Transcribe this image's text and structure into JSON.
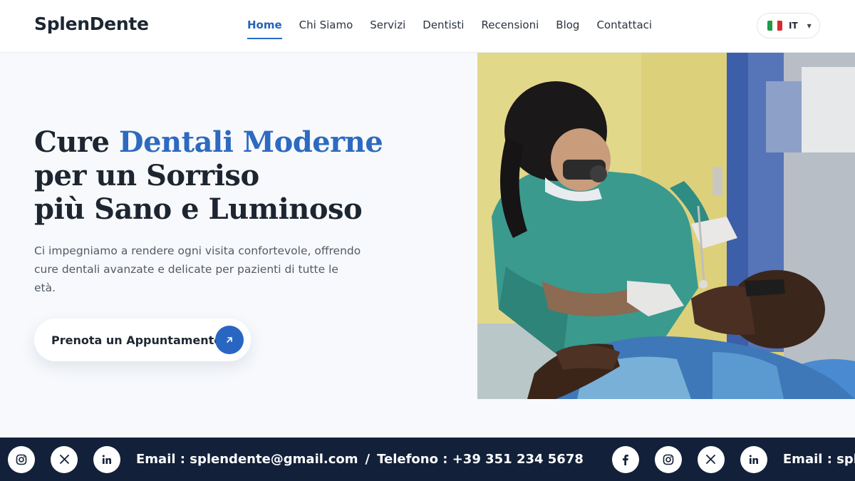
{
  "brand": {
    "name": "SplenDente"
  },
  "nav": {
    "items": [
      {
        "label": "Home",
        "active": true
      },
      {
        "label": "Chi Siamo",
        "active": false
      },
      {
        "label": "Servizi",
        "active": false
      },
      {
        "label": "Dentisti",
        "active": false
      },
      {
        "label": "Recensioni",
        "active": false
      },
      {
        "label": "Blog",
        "active": false
      },
      {
        "label": "Contattaci",
        "active": false
      }
    ]
  },
  "language": {
    "code": "IT",
    "flag": "italy-flag-icon",
    "colors": [
      "#1f9b4a",
      "#ffffff",
      "#d62b30"
    ]
  },
  "hero": {
    "title_part1": "Cure ",
    "title_accent": "Dentali Moderne",
    "title_line2": "per un Sorriso",
    "title_line3": "più Sano e Luminoso",
    "description": "Ci impegniamo a rendere ogni visita confortevole, offrendo cure dentali avanzate e delicate per pazienti di tutte le età.",
    "cta_label": "Prenota un Appuntamento",
    "cta_icon": "arrow-up-right-icon"
  },
  "photo": {
    "icon": "dentist-treating-patient-image"
  },
  "ticker": {
    "contact_email": "Email : splendente@gmail.com",
    "separator": "/",
    "contact_phone": "Telefono : +39 351 234 5678",
    "contact_email_repeat": "Email : splendente@",
    "socials": [
      "instagram-icon",
      "x-icon",
      "linkedin-icon",
      "facebook-icon"
    ]
  },
  "colors": {
    "accent": "#2d6ac0",
    "footer_bg": "#13203a",
    "hero_bg": "#f7f9fc"
  }
}
